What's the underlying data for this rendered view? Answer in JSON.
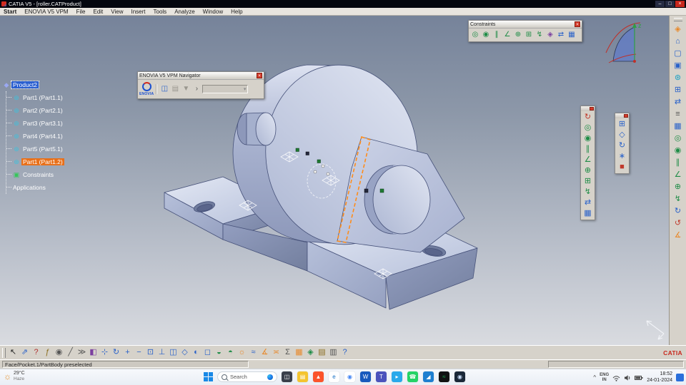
{
  "window": {
    "title": "CATIA V5 - [roller.CATProduct]",
    "controls": {
      "minimize": "–",
      "maximize": "□",
      "close": "×"
    }
  },
  "menubar": {
    "items": [
      {
        "name": "menu-start",
        "label": "Start"
      },
      {
        "name": "menu-enovia-v5-vpm",
        "label": "ENOVIA V5 VPM"
      },
      {
        "name": "menu-file",
        "label": "File"
      },
      {
        "name": "menu-edit",
        "label": "Edit"
      },
      {
        "name": "menu-view",
        "label": "View"
      },
      {
        "name": "menu-insert",
        "label": "Insert"
      },
      {
        "name": "menu-tools",
        "label": "Tools"
      },
      {
        "name": "menu-analyze",
        "label": "Analyze"
      },
      {
        "name": "menu-window",
        "label": "Window"
      },
      {
        "name": "menu-help",
        "label": "Help"
      }
    ]
  },
  "tree": {
    "root": "Product2",
    "product_glyph": "◆",
    "part_glyph": "⊛",
    "constraint_glyph": "▣",
    "parts": [
      {
        "name": "tree-item-part1-1",
        "label": "Part1 (Part1.1)",
        "bg": ""
      },
      {
        "name": "tree-item-part2-1",
        "label": "Part2 (Part2.1)",
        "bg": ""
      },
      {
        "name": "tree-item-part3-1",
        "label": "Part3 (Part3.1)",
        "bg": ""
      },
      {
        "name": "tree-item-part4-1",
        "label": "Part4 (Part4.1)",
        "bg": ""
      },
      {
        "name": "tree-item-part5-1",
        "label": "Part5 (Part5.1)",
        "bg": ""
      },
      {
        "name": "tree-item-part1-2",
        "label": "Part1 (Part1.2)",
        "bg": "#e8701a"
      }
    ],
    "constraints_label": "Constraints",
    "applications_label": "Applications"
  },
  "constraints_toolbar": {
    "title": "Constraints",
    "icons": [
      {
        "name": "coincidence-constraint-icon",
        "glyph": "◎",
        "color": "#1e8c46"
      },
      {
        "name": "contact-constraint-icon",
        "glyph": "◉",
        "color": "#1e8c46"
      },
      {
        "name": "offset-constraint-icon",
        "glyph": "∥",
        "color": "#1e8c46"
      },
      {
        "name": "angle-constraint-icon",
        "glyph": "∠",
        "color": "#1e8c46"
      },
      {
        "name": "fix-constraint-icon",
        "glyph": "⊕",
        "color": "#1e8c46"
      },
      {
        "name": "fix-together-constraint-icon",
        "glyph": "⊞",
        "color": "#1e8c46"
      },
      {
        "name": "quick-constraint-icon",
        "glyph": "↯",
        "color": "#1e8c46"
      },
      {
        "name": "flexible-rigid-sub-assembly-icon",
        "glyph": "◈",
        "color": "#7b3fa0"
      },
      {
        "name": "change-constraint-icon",
        "glyph": "⇄",
        "color": "#2a62c9"
      },
      {
        "name": "reuse-pattern-icon",
        "glyph": "▦",
        "color": "#2a62c9"
      }
    ]
  },
  "enovia_toolbar": {
    "title": "ENOVIA V5 VPM Navigator",
    "logo_word": "ENOVIA",
    "combo_arrow": "▾",
    "icons": [
      {
        "name": "connect-to-enovia-icon",
        "glyph": "◫",
        "color": "#2a62c9"
      },
      {
        "name": "open-from-enovia-icon",
        "glyph": "▤",
        "color": "#9a978f"
      },
      {
        "name": "save-in-enovia-icon",
        "glyph": "▼",
        "color": "#9a978f"
      },
      {
        "name": "more-options-arrow-icon",
        "glyph": "›",
        "color": "#555555"
      }
    ]
  },
  "strip_a": {
    "icons": [
      {
        "name": "update-assembly-icon",
        "glyph": "↻",
        "color": "#c0392b"
      },
      {
        "name": "coincidence-constraint-icon",
        "glyph": "◎",
        "color": "#1e8c46"
      },
      {
        "name": "contact-constraint-icon",
        "glyph": "◉",
        "color": "#1e8c46"
      },
      {
        "name": "offset-constraint-icon",
        "glyph": "∥",
        "color": "#1e8c46"
      },
      {
        "name": "angle-constraint-icon",
        "glyph": "∠",
        "color": "#1e8c46"
      },
      {
        "name": "anchor-constraint-icon",
        "glyph": "⊕",
        "color": "#1e8c46"
      },
      {
        "name": "fix-together-icon",
        "glyph": "⊞",
        "color": "#1e8c46"
      },
      {
        "name": "quick-constraint-icon",
        "glyph": "↯",
        "color": "#1e8c46"
      },
      {
        "name": "change-constraint-icon",
        "glyph": "⇄",
        "color": "#2a62c9"
      },
      {
        "name": "reuse-pattern-icon",
        "glyph": "▦",
        "color": "#2a62c9"
      }
    ]
  },
  "strip_b": {
    "icons": [
      {
        "name": "manipulation-icon",
        "glyph": "⊞",
        "color": "#2a62c9"
      },
      {
        "name": "snap-icon",
        "glyph": "◇",
        "color": "#2a62c9"
      },
      {
        "name": "smart-move-icon",
        "glyph": "↻",
        "color": "#2a62c9"
      },
      {
        "name": "explode-icon",
        "glyph": "∗",
        "color": "#2a62c9"
      },
      {
        "name": "stop-manipulation-icon",
        "glyph": "■",
        "color": "#c0392b"
      }
    ]
  },
  "dock": {
    "icons": [
      {
        "name": "assembly-workbench-icon",
        "glyph": "◈",
        "color": "#e8892b"
      },
      {
        "name": "product-structure-icon",
        "glyph": "⌂",
        "color": "#2a62c9"
      },
      {
        "name": "new-component-icon",
        "glyph": "▢",
        "color": "#2a62c9"
      },
      {
        "name": "new-product-icon",
        "glyph": "▣",
        "color": "#2a62c9"
      },
      {
        "name": "new-part-icon",
        "glyph": "⊛",
        "color": "#18a0c4"
      },
      {
        "name": "existing-component-icon",
        "glyph": "⊞",
        "color": "#2a62c9"
      },
      {
        "name": "replace-component-icon",
        "glyph": "⇄",
        "color": "#2a62c9"
      },
      {
        "name": "graph-tree-reordering-icon",
        "glyph": "≡",
        "color": "#555555"
      },
      {
        "name": "multi-instantiation-icon",
        "glyph": "▦",
        "color": "#2a62c9"
      },
      {
        "name": "coincidence-constraint-icon",
        "glyph": "◎",
        "color": "#1e8c46"
      },
      {
        "name": "contact-constraint-icon",
        "glyph": "◉",
        "color": "#1e8c46"
      },
      {
        "name": "offset-constraint-icon",
        "glyph": "∥",
        "color": "#1e8c46"
      },
      {
        "name": "angle-constraint-icon",
        "glyph": "∠",
        "color": "#1e8c46"
      },
      {
        "name": "fix-component-icon",
        "glyph": "⊕",
        "color": "#1e8c46"
      },
      {
        "name": "quick-constraint-icon",
        "glyph": "↯",
        "color": "#1e8c46"
      },
      {
        "name": "smart-move-icon",
        "glyph": "↻",
        "color": "#2a62c9"
      },
      {
        "name": "update-all-icon",
        "glyph": "↺",
        "color": "#c0392b"
      },
      {
        "name": "measure-icon",
        "glyph": "∡",
        "color": "#e8892b"
      }
    ]
  },
  "bottom_toolbar": {
    "icons": [
      {
        "name": "select-arrow-icon",
        "glyph": "↖",
        "color": "#222222"
      },
      {
        "name": "fly-mode-icon",
        "glyph": "⇗",
        "color": "#2a62c9"
      },
      {
        "name": "help-icon",
        "glyph": "?",
        "color": "#b03030"
      },
      {
        "name": "formula-icon",
        "glyph": "ƒ",
        "color": "#8a6d1f"
      },
      {
        "name": "image-capture-icon",
        "glyph": "◉",
        "color": "#555555"
      },
      {
        "name": "sketch-tracer-icon",
        "glyph": "╱",
        "color": "#555555"
      },
      {
        "name": "macros-icon",
        "glyph": "≫",
        "color": "#555555"
      },
      {
        "name": "apply-material-icon",
        "glyph": "◧",
        "color": "#7b3fa0"
      },
      {
        "name": "pan-icon",
        "glyph": "⊹",
        "color": "#2a62c9"
      },
      {
        "name": "rotate-view-icon",
        "glyph": "↻",
        "color": "#2a62c9"
      },
      {
        "name": "zoom-in-icon",
        "glyph": "+",
        "color": "#2a62c9"
      },
      {
        "name": "zoom-out-icon",
        "glyph": "−",
        "color": "#2a62c9"
      },
      {
        "name": "fit-all-in-icon",
        "glyph": "⊡",
        "color": "#2a62c9"
      },
      {
        "name": "normal-view-icon",
        "glyph": "⊥",
        "color": "#2a62c9"
      },
      {
        "name": "multi-view-icon",
        "glyph": "◫",
        "color": "#2a62c9"
      },
      {
        "name": "isometric-view-icon",
        "glyph": "◇",
        "color": "#2a62c9"
      },
      {
        "name": "shading-icon",
        "glyph": "◐",
        "color": "#2a62c9"
      },
      {
        "name": "wireframe-icon",
        "glyph": "◻",
        "color": "#2a62c9"
      },
      {
        "name": "hide-show-icon",
        "glyph": "◒",
        "color": "#1e8c46"
      },
      {
        "name": "swap-visible-space-icon",
        "glyph": "◓",
        "color": "#1e8c46"
      },
      {
        "name": "light-effect-icon",
        "glyph": "☼",
        "color": "#e8892b"
      },
      {
        "name": "depth-effect-icon",
        "glyph": "≈",
        "color": "#2a62c9"
      },
      {
        "name": "measure-between-icon",
        "glyph": "∡",
        "color": "#e8892b"
      },
      {
        "name": "measure-item-icon",
        "glyph": "≍",
        "color": "#e8892b"
      },
      {
        "name": "mass-properties-icon",
        "glyph": "Σ",
        "color": "#555555"
      },
      {
        "name": "grid-icon",
        "glyph": "▦",
        "color": "#e8892b"
      },
      {
        "name": "knowledge-icon",
        "glyph": "◈",
        "color": "#1e8c46"
      },
      {
        "name": "catalog-browser-icon",
        "glyph": "▤",
        "color": "#8a6d1f"
      },
      {
        "name": "paste-special-icon",
        "glyph": "▥",
        "color": "#555555"
      },
      {
        "name": "what-is-this-icon",
        "glyph": "?",
        "color": "#2a62c9"
      }
    ]
  },
  "branding": {
    "catia_logo": "CATIA"
  },
  "statusbar": {
    "message": "Face/Pocket.1/PartBody preselected"
  },
  "compass": {
    "z_label": "z"
  },
  "taskbar": {
    "weather": {
      "icon_glyph": "☼",
      "temp": "29°C",
      "desc": "Haze"
    },
    "search_label": "Search",
    "apps": [
      {
        "name": "task-view-icon",
        "glyph": "◫",
        "bg": "#3a3f4a",
        "fg": "#ffffff"
      },
      {
        "name": "file-explorer-icon",
        "glyph": "▤",
        "bg": "#f4c430",
        "fg": "#ffffff"
      },
      {
        "name": "brave-browser-icon",
        "glyph": "▲",
        "bg": "#fb542b",
        "fg": "#ffffff"
      },
      {
        "name": "edge-browser-icon",
        "glyph": "e",
        "bg": "#ffffff",
        "fg": "#1a73c7"
      },
      {
        "name": "chrome-browser-icon",
        "glyph": "◉",
        "bg": "#ffffff",
        "fg": "#4285f4"
      },
      {
        "name": "word-app-icon",
        "glyph": "W",
        "bg": "#185abd",
        "fg": "#ffffff"
      },
      {
        "name": "teams-app-icon",
        "glyph": "T",
        "bg": "#4b53bc",
        "fg": "#ffffff"
      },
      {
        "name": "telegram-app-icon",
        "glyph": "▸",
        "bg": "#29a9eb",
        "fg": "#ffffff"
      },
      {
        "name": "whatsapp-app-icon",
        "glyph": "☎",
        "bg": "#25d366",
        "fg": "#ffffff"
      },
      {
        "name": "vscode-app-icon",
        "glyph": "◢",
        "bg": "#1e7fd0",
        "fg": "#ffffff"
      },
      {
        "name": "spotify-app-icon",
        "glyph": "≈",
        "bg": "#121212",
        "fg": "#1db954"
      },
      {
        "name": "steam-app-icon",
        "glyph": "◉",
        "bg": "#1b2838",
        "fg": "#cfe3ff"
      }
    ],
    "tray": {
      "chevron": "^",
      "lang": "ENG",
      "region": "IN",
      "time": "18:52",
      "date": "24-01-2024"
    }
  },
  "colors": {
    "preselect_highlight": "#ff8c1a",
    "tree_select_blue": "#2a5fd0",
    "tree_select_orange": "#e8701a"
  }
}
